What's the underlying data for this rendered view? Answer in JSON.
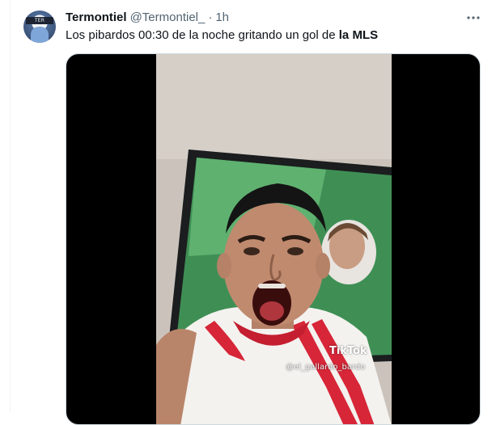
{
  "tweet": {
    "author": {
      "display_name": "Termontiel",
      "handle": "@Termontiel_",
      "separator": "·",
      "time": "1h",
      "avatar_icon": "profile-avatar"
    },
    "text_plain": "Los pibardos 00:30 de la noche gritando un gol de ",
    "text_bold": "la MLS",
    "more_icon": "more-horizontal-icon",
    "media": {
      "type": "video",
      "watermark_brand": "TikTok",
      "watermark_handle": "@el_gallardo_bardo"
    }
  },
  "colors": {
    "text_primary": "#0f1419",
    "text_secondary": "#536471",
    "border": "#cfd9de",
    "jersey_red": "#d72638"
  }
}
